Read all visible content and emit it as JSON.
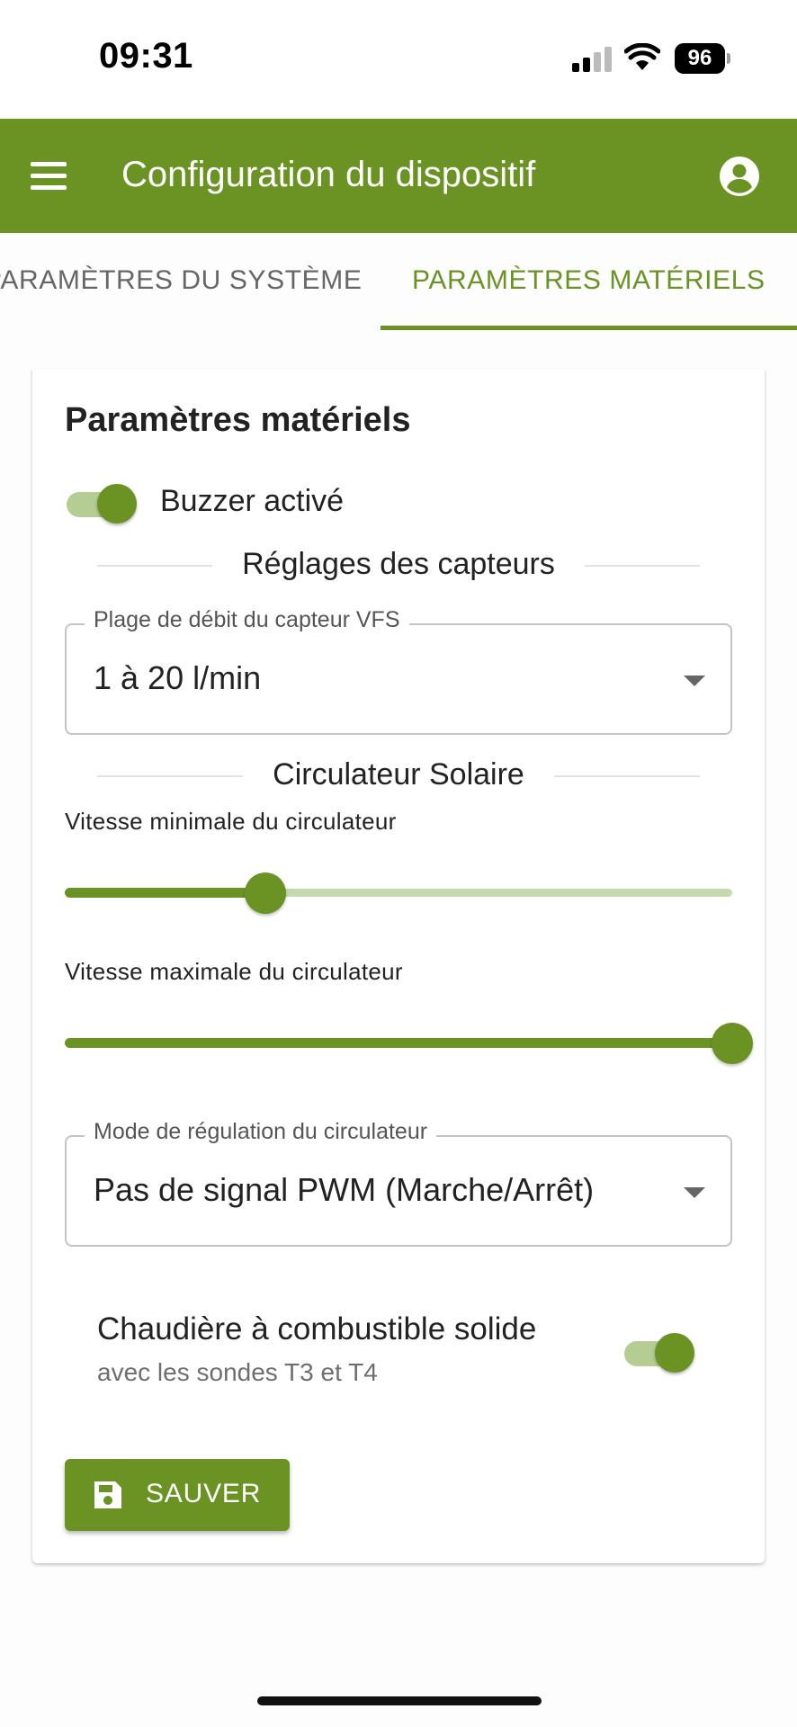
{
  "status_bar": {
    "time": "09:31",
    "battery": "96",
    "signal_icon": "cellular-signal-icon",
    "wifi_icon": "wifi-icon"
  },
  "app_bar": {
    "title": "Configuration du dispositif",
    "menu_icon": "menu-icon",
    "account_icon": "account-circle-icon",
    "background": "#6a9323"
  },
  "tabs": [
    {
      "label": "PARAMÈTRES DU SYSTÈME",
      "active": false
    },
    {
      "label": "PARAMÈTRES MATÉRIELS",
      "active": true
    }
  ],
  "card": {
    "title": "Paramètres matériels",
    "buzzer": {
      "label": "Buzzer activé",
      "enabled": true
    },
    "sensors_section": "Réglages des capteurs",
    "vfs_select": {
      "legend": "Plage de débit du capteur VFS",
      "value": "1 à 20 l/min"
    },
    "circulator_section": "Circulateur Solaire",
    "min_speed": {
      "label": "Vitesse minimale du circulateur",
      "fraction": 0.3
    },
    "max_speed": {
      "label": "Vitesse maximale du circulateur",
      "fraction": 1.0
    },
    "mode_select": {
      "legend": "Mode de régulation du circulateur",
      "value": "Pas de signal PWM (Marche/Arrêt)"
    },
    "solid_fuel_boiler": {
      "title": "Chaudière à combustible solide",
      "subtitle": "avec les sondes T3 et T4",
      "enabled": true
    },
    "save_button": {
      "label": "SAUVER",
      "icon": "save-icon"
    }
  },
  "colors": {
    "accent": "#6a9323",
    "accent_light": "#b5cc92",
    "tab_inactive": "#666666"
  }
}
